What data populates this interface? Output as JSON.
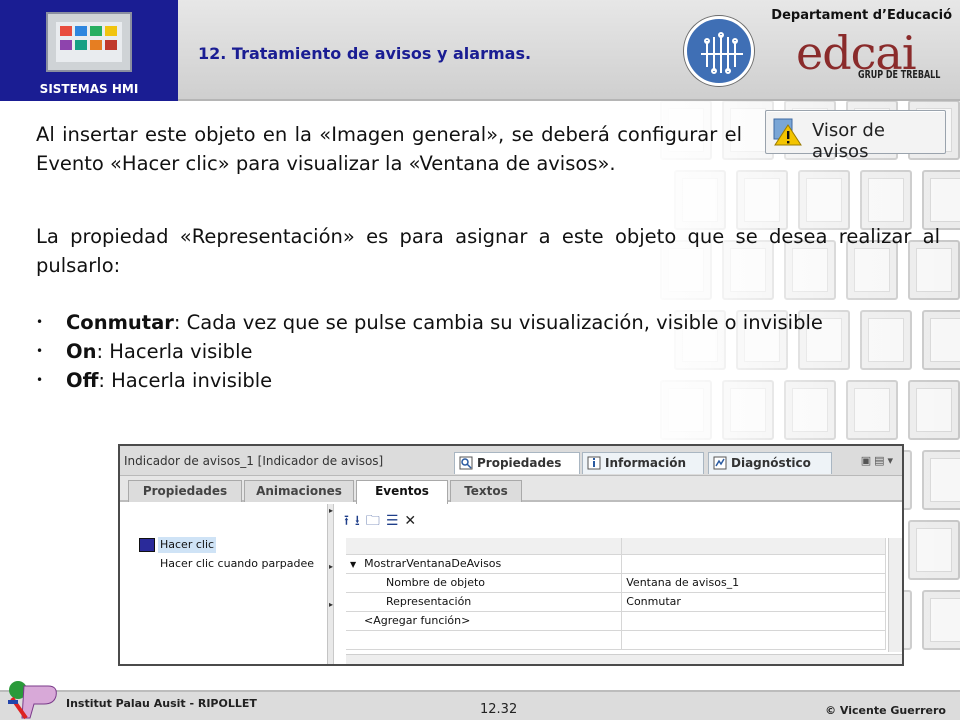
{
  "header": {
    "hmi_label": "SISTEMAS HMI",
    "slide_title": "12. Tratamiento de avisos y alarmas.",
    "department": "Departament d’Educació",
    "logo_text": "edcai",
    "logo_subtext": "GRUP DE TREBALL"
  },
  "content": {
    "paragraph1": "Al insertar este objeto en la «Imagen general», se deberá configurar el Evento «Hacer clic» para visualizar la «Ventana de avisos».",
    "paragraph2": "La propiedad «Representación» es para asignar a este objeto que se desea realizar al pulsarlo:",
    "bullets": [
      {
        "term": "Conmutar",
        "text": ": Cada vez que se pulse cambia su visualización, visible o invisible"
      },
      {
        "term": "On",
        "text": ": Hacerla visible"
      },
      {
        "term": "Off",
        "text": ": Hacerla invisible"
      }
    ]
  },
  "visor_button": {
    "label": "Visor de avisos",
    "icon": "warning-icon"
  },
  "inspector": {
    "title": "Indicador de avisos_1 [Indicador de avisos]",
    "tabs": [
      {
        "label": "Propiedades",
        "icon": "properties-icon",
        "active": true
      },
      {
        "label": "Información",
        "icon": "info-icon",
        "active": false
      },
      {
        "label": "Diagnóstico",
        "icon": "diagnostics-icon",
        "active": false
      }
    ],
    "subtabs": [
      "Propiedades",
      "Animaciones",
      "Eventos",
      "Textos"
    ],
    "active_subtab": "Eventos",
    "events": [
      {
        "label": "Hacer clic",
        "selected": true
      },
      {
        "label": "Hacer clic cuando parpadee",
        "selected": false
      }
    ],
    "functions": {
      "function_name": "MostrarVentanaDeAvisos",
      "params": [
        {
          "name": "Nombre de objeto",
          "value": "Ventana de avisos_1"
        },
        {
          "name": "Representación",
          "value": "Conmutar"
        }
      ],
      "add_function": "<Agregar función>"
    }
  },
  "footer": {
    "institute": "Institut Palau Ausit - RIPOLLET",
    "page": "12.32",
    "author": "© Vicente Guerrero"
  },
  "colors": {
    "accent_blue": "#1a1d93",
    "selection": "#cfe3f6",
    "warning_yellow": "#f3c400"
  }
}
